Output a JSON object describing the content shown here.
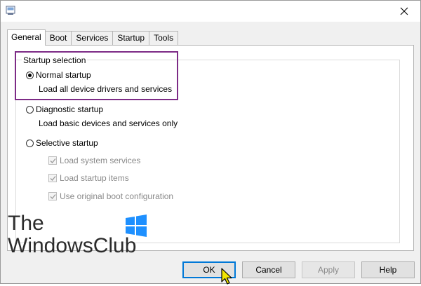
{
  "tabs": [
    {
      "label": "General",
      "active": true
    },
    {
      "label": "Boot",
      "active": false
    },
    {
      "label": "Services",
      "active": false
    },
    {
      "label": "Startup",
      "active": false
    },
    {
      "label": "Tools",
      "active": false
    }
  ],
  "group": {
    "title": "Startup selection",
    "normal": {
      "label": "Normal startup",
      "desc": "Load all device drivers and services",
      "selected": true
    },
    "diagnostic": {
      "label": "Diagnostic startup",
      "desc": "Load basic devices and services only",
      "selected": false
    },
    "selective": {
      "label": "Selective startup",
      "selected": false
    },
    "options": [
      {
        "label": "Load system services",
        "checked": true
      },
      {
        "label": "Load startup items",
        "checked": true
      },
      {
        "label": "Use original boot configuration",
        "checked": true
      }
    ]
  },
  "watermark": {
    "line1": "The",
    "line2": "WindowsClub"
  },
  "buttons": {
    "ok": "OK",
    "cancel": "Cancel",
    "apply": "Apply",
    "help": "Help"
  },
  "colors": {
    "highlight": "#7d2b86",
    "accent": "#0078d7",
    "windows_logo": "#1e90ff"
  },
  "icons": {
    "title": "msconfig-icon",
    "close": "close-icon",
    "cursor": "mouse-pointer-icon",
    "logo": "windows-logo-icon"
  }
}
